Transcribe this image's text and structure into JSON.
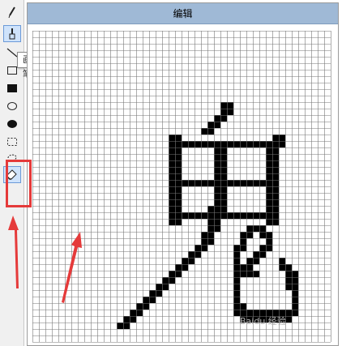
{
  "window": {
    "title": "编辑"
  },
  "toolbar": {
    "tools": [
      {
        "name": "pencil",
        "icon": "pencil-icon"
      },
      {
        "name": "brush",
        "icon": "brush-icon",
        "selected": true
      },
      {
        "name": "line",
        "icon": "line-icon"
      },
      {
        "name": "rectangle",
        "icon": "rectangle-icon"
      },
      {
        "name": "filled-rectangle",
        "icon": "filled-rectangle-icon"
      },
      {
        "name": "ellipse",
        "icon": "ellipse-icon"
      },
      {
        "name": "filled-ellipse",
        "icon": "filled-ellipse-icon"
      },
      {
        "name": "selection",
        "icon": "dashed-rectangle-icon"
      },
      {
        "name": "lasso",
        "icon": "lasso-icon"
      },
      {
        "name": "eraser",
        "icon": "eraser-icon",
        "selected": true
      }
    ],
    "tooltip": "画笔"
  },
  "canvas": {
    "grid_line_color": "#777777",
    "pixel_color": "#000000",
    "background": "#ffffff",
    "filled_cells": [
      [
        29,
        11
      ],
      [
        30,
        11
      ],
      [
        29,
        12
      ],
      [
        30,
        12
      ],
      [
        28,
        13
      ],
      [
        29,
        13
      ],
      [
        27,
        14
      ],
      [
        28,
        14
      ],
      [
        26,
        15
      ],
      [
        27,
        15
      ],
      [
        21,
        16
      ],
      [
        22,
        16
      ],
      [
        37,
        16
      ],
      [
        38,
        16
      ],
      [
        21,
        17
      ],
      [
        22,
        17
      ],
      [
        23,
        17
      ],
      [
        24,
        17
      ],
      [
        25,
        17
      ],
      [
        26,
        17
      ],
      [
        27,
        17
      ],
      [
        28,
        17
      ],
      [
        29,
        17
      ],
      [
        30,
        17
      ],
      [
        31,
        17
      ],
      [
        32,
        17
      ],
      [
        33,
        17
      ],
      [
        34,
        17
      ],
      [
        35,
        17
      ],
      [
        36,
        17
      ],
      [
        37,
        17
      ],
      [
        38,
        17
      ],
      [
        21,
        18
      ],
      [
        22,
        18
      ],
      [
        28,
        18
      ],
      [
        29,
        18
      ],
      [
        36,
        18
      ],
      [
        37,
        18
      ],
      [
        21,
        19
      ],
      [
        22,
        19
      ],
      [
        28,
        19
      ],
      [
        29,
        19
      ],
      [
        36,
        19
      ],
      [
        37,
        19
      ],
      [
        21,
        20
      ],
      [
        22,
        20
      ],
      [
        28,
        20
      ],
      [
        29,
        20
      ],
      [
        36,
        20
      ],
      [
        37,
        20
      ],
      [
        21,
        21
      ],
      [
        22,
        21
      ],
      [
        28,
        21
      ],
      [
        29,
        21
      ],
      [
        36,
        21
      ],
      [
        37,
        21
      ],
      [
        21,
        22
      ],
      [
        22,
        22
      ],
      [
        28,
        22
      ],
      [
        29,
        22
      ],
      [
        36,
        22
      ],
      [
        37,
        22
      ],
      [
        21,
        23
      ],
      [
        22,
        23
      ],
      [
        23,
        23
      ],
      [
        24,
        23
      ],
      [
        25,
        23
      ],
      [
        26,
        23
      ],
      [
        27,
        23
      ],
      [
        28,
        23
      ],
      [
        29,
        23
      ],
      [
        30,
        23
      ],
      [
        31,
        23
      ],
      [
        32,
        23
      ],
      [
        33,
        23
      ],
      [
        34,
        23
      ],
      [
        35,
        23
      ],
      [
        36,
        23
      ],
      [
        37,
        23
      ],
      [
        21,
        24
      ],
      [
        22,
        24
      ],
      [
        28,
        24
      ],
      [
        29,
        24
      ],
      [
        36,
        24
      ],
      [
        37,
        24
      ],
      [
        21,
        25
      ],
      [
        22,
        25
      ],
      [
        28,
        25
      ],
      [
        29,
        25
      ],
      [
        36,
        25
      ],
      [
        37,
        25
      ],
      [
        21,
        26
      ],
      [
        22,
        26
      ],
      [
        28,
        26
      ],
      [
        29,
        26
      ],
      [
        36,
        26
      ],
      [
        37,
        26
      ],
      [
        21,
        27
      ],
      [
        22,
        27
      ],
      [
        27,
        27
      ],
      [
        28,
        27
      ],
      [
        29,
        27
      ],
      [
        36,
        27
      ],
      [
        37,
        27
      ],
      [
        21,
        28
      ],
      [
        22,
        28
      ],
      [
        23,
        28
      ],
      [
        24,
        28
      ],
      [
        25,
        28
      ],
      [
        26,
        28
      ],
      [
        27,
        28
      ],
      [
        28,
        28
      ],
      [
        29,
        28
      ],
      [
        30,
        28
      ],
      [
        31,
        28
      ],
      [
        32,
        28
      ],
      [
        33,
        28
      ],
      [
        34,
        28
      ],
      [
        35,
        28
      ],
      [
        36,
        28
      ],
      [
        37,
        28
      ],
      [
        21,
        29
      ],
      [
        22,
        29
      ],
      [
        27,
        29
      ],
      [
        28,
        29
      ],
      [
        36,
        29
      ],
      [
        37,
        29
      ],
      [
        27,
        30
      ],
      [
        28,
        30
      ],
      [
        33,
        30
      ],
      [
        34,
        30
      ],
      [
        35,
        30
      ],
      [
        26,
        31
      ],
      [
        27,
        31
      ],
      [
        32,
        31
      ],
      [
        33,
        31
      ],
      [
        35,
        31
      ],
      [
        36,
        31
      ],
      [
        26,
        32
      ],
      [
        27,
        32
      ],
      [
        32,
        32
      ],
      [
        36,
        32
      ],
      [
        25,
        33
      ],
      [
        26,
        33
      ],
      [
        31,
        33
      ],
      [
        32,
        33
      ],
      [
        35,
        33
      ],
      [
        36,
        33
      ],
      [
        24,
        34
      ],
      [
        25,
        34
      ],
      [
        31,
        34
      ],
      [
        34,
        34
      ],
      [
        35,
        34
      ],
      [
        23,
        35
      ],
      [
        24,
        35
      ],
      [
        31,
        35
      ],
      [
        33,
        35
      ],
      [
        34,
        35
      ],
      [
        38,
        35
      ],
      [
        22,
        36
      ],
      [
        23,
        36
      ],
      [
        31,
        36
      ],
      [
        32,
        36
      ],
      [
        33,
        36
      ],
      [
        38,
        36
      ],
      [
        39,
        36
      ],
      [
        21,
        37
      ],
      [
        22,
        37
      ],
      [
        31,
        37
      ],
      [
        32,
        37
      ],
      [
        33,
        37
      ],
      [
        34,
        37
      ],
      [
        39,
        37
      ],
      [
        40,
        37
      ],
      [
        20,
        38
      ],
      [
        21,
        38
      ],
      [
        31,
        38
      ],
      [
        39,
        38
      ],
      [
        40,
        38
      ],
      [
        19,
        39
      ],
      [
        20,
        39
      ],
      [
        31,
        39
      ],
      [
        39,
        39
      ],
      [
        40,
        39
      ],
      [
        18,
        40
      ],
      [
        19,
        40
      ],
      [
        31,
        40
      ],
      [
        40,
        40
      ],
      [
        17,
        41
      ],
      [
        18,
        41
      ],
      [
        31,
        41
      ],
      [
        40,
        41
      ],
      [
        16,
        42
      ],
      [
        17,
        42
      ],
      [
        31,
        42
      ],
      [
        32,
        42
      ],
      [
        40,
        42
      ],
      [
        15,
        43
      ],
      [
        16,
        43
      ],
      [
        31,
        43
      ],
      [
        32,
        43
      ],
      [
        33,
        43
      ],
      [
        34,
        43
      ],
      [
        35,
        43
      ],
      [
        36,
        43
      ],
      [
        37,
        43
      ],
      [
        38,
        43
      ],
      [
        39,
        43
      ],
      [
        40,
        43
      ],
      [
        14,
        44
      ],
      [
        15,
        44
      ],
      [
        32,
        44
      ],
      [
        33,
        44
      ],
      [
        34,
        44
      ],
      [
        35,
        44
      ],
      [
        36,
        44
      ],
      [
        37,
        44
      ],
      [
        38,
        44
      ],
      [
        39,
        44
      ],
      [
        13,
        45
      ],
      [
        14,
        45
      ]
    ]
  },
  "watermark": "Baidu 经验"
}
